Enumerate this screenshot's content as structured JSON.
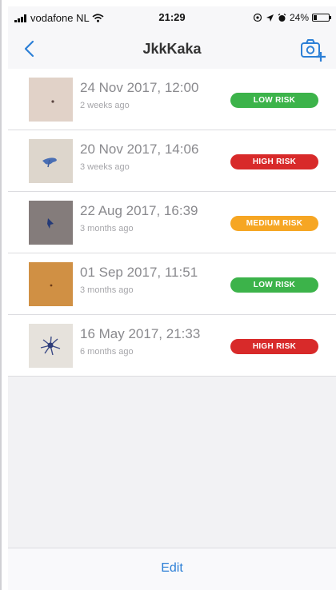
{
  "status_bar": {
    "carrier": "vodafone NL",
    "time": "21:29",
    "battery": "24%",
    "battery_level": 0.24,
    "icons": [
      "signal-icon",
      "wifi-icon",
      "location-icon",
      "alarm-icon",
      "battery-icon"
    ]
  },
  "nav": {
    "title": "JkkKaka",
    "back_icon": "chevron-left-icon",
    "camera_icon": "add-photo-camera-icon",
    "accent": "#2c7fd6"
  },
  "entries": [
    {
      "date": "24 Nov 2017, 12:00",
      "ago": "2 weeks ago",
      "risk": "LOW RISK",
      "color": "#3cb34a"
    },
    {
      "date": "20 Nov 2017, 14:06",
      "ago": "3 weeks ago",
      "risk": "HIGH RISK",
      "color": "#d82a2a"
    },
    {
      "date": "22 Aug 2017, 16:39",
      "ago": "3 months ago",
      "risk": "MEDIUM RISK",
      "color": "#f6a623"
    },
    {
      "date": "01 Sep 2017, 11:51",
      "ago": "3 months ago",
      "risk": "LOW RISK",
      "color": "#3cb34a"
    },
    {
      "date": "16 May 2017, 21:33",
      "ago": "6 months ago",
      "risk": "HIGH RISK",
      "color": "#d82a2a"
    }
  ],
  "footer": {
    "edit_label": "Edit"
  }
}
